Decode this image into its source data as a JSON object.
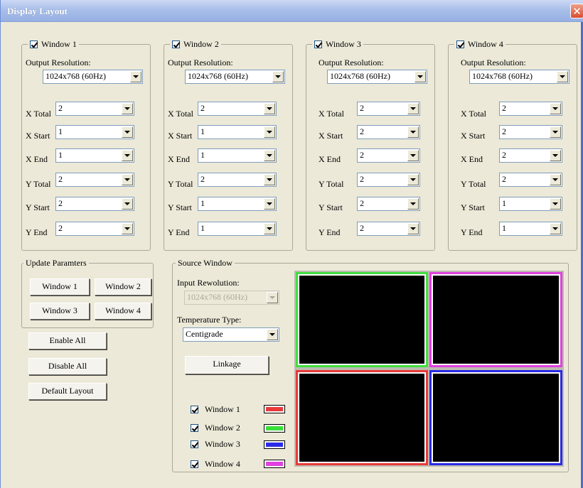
{
  "window": {
    "title": "Display Layout"
  },
  "windows": [
    {
      "label": "Window 1",
      "checked": true,
      "output_res_label": "Output Resolution:",
      "output_res": "1024x768 (60Hz)",
      "fields": [
        {
          "label": "X Total",
          "value": "2"
        },
        {
          "label": "X Start",
          "value": "1"
        },
        {
          "label": "X End",
          "value": "1"
        },
        {
          "label": "Y Total",
          "value": "2"
        },
        {
          "label": "Y Start",
          "value": "2"
        },
        {
          "label": "Y End",
          "value": "2"
        }
      ]
    },
    {
      "label": "Window 2",
      "checked": true,
      "output_res_label": "Output Resolution:",
      "output_res": "1024x768 (60Hz)",
      "fields": [
        {
          "label": "X Total",
          "value": "2"
        },
        {
          "label": "X Start",
          "value": "1"
        },
        {
          "label": "X End",
          "value": "1"
        },
        {
          "label": "Y Total",
          "value": "2"
        },
        {
          "label": "Y Start",
          "value": "1"
        },
        {
          "label": "Y End",
          "value": "1"
        }
      ]
    },
    {
      "label": "Window 3",
      "checked": true,
      "output_res_label": "Output Resolution:",
      "output_res": "1024x768 (60Hz)",
      "fields": [
        {
          "label": "X Total",
          "value": "2"
        },
        {
          "label": "X Start",
          "value": "2"
        },
        {
          "label": "X End",
          "value": "2"
        },
        {
          "label": "Y Total",
          "value": "2"
        },
        {
          "label": "Y Start",
          "value": "2"
        },
        {
          "label": "Y End",
          "value": "2"
        }
      ]
    },
    {
      "label": "Window 4",
      "checked": true,
      "output_res_label": "Output Resolution:",
      "output_res": "1024x768 (60Hz)",
      "fields": [
        {
          "label": "X Total",
          "value": "2"
        },
        {
          "label": "X Start",
          "value": "2"
        },
        {
          "label": "X End",
          "value": "2"
        },
        {
          "label": "Y Total",
          "value": "2"
        },
        {
          "label": "Y Start",
          "value": "1"
        },
        {
          "label": "Y End",
          "value": "1"
        }
      ]
    }
  ],
  "update": {
    "legend": "Update Paramters",
    "buttons": [
      "Window 1",
      "Window 2",
      "Window 3",
      "Window 4"
    ]
  },
  "actions": {
    "enable_all": "Enable All",
    "disable_all": "Disable All",
    "default_layout": "Default Layout"
  },
  "source": {
    "legend": "Source Window",
    "input_res_label": "Input Rewolution:",
    "input_res": "1024x768 (60Hz)",
    "temp_label": "Temperature Type:",
    "temp_value": "Centigrade",
    "linkage": "Linkage",
    "toggles": [
      {
        "label": "Window 1",
        "checked": true,
        "color": "#e83a3a"
      },
      {
        "label": "Window 2",
        "checked": true,
        "color": "#3adf3a"
      },
      {
        "label": "Window 3",
        "checked": true,
        "color": "#2a2ae8"
      },
      {
        "label": "Window 4",
        "checked": true,
        "color": "#e040e0"
      }
    ]
  },
  "preview": {
    "panes": [
      {
        "name": "window-2",
        "border_color": "#40e040"
      },
      {
        "name": "window-4",
        "border_color": "#e040e0"
      },
      {
        "name": "window-1",
        "border_color": "#e83a3a"
      },
      {
        "name": "window-3",
        "border_color": "#2a2ae8"
      }
    ]
  }
}
